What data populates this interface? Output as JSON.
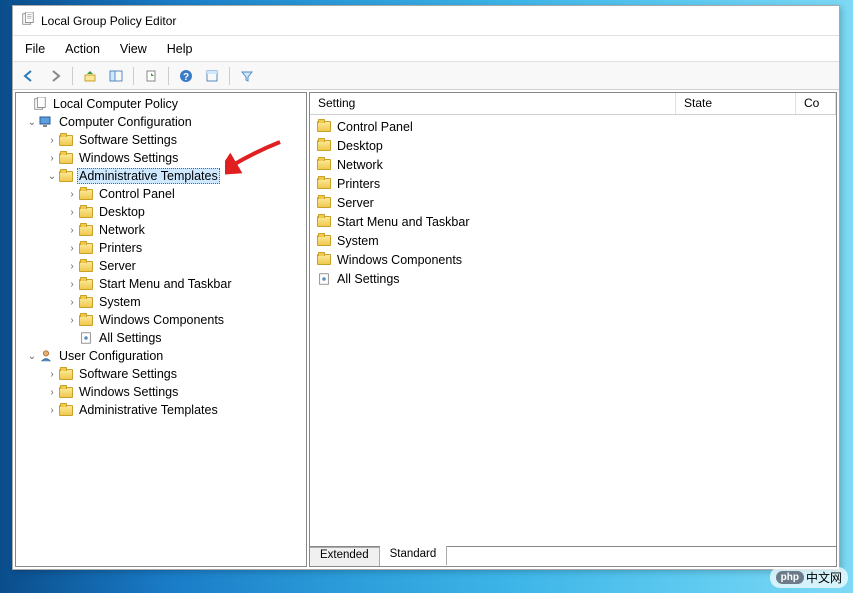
{
  "window": {
    "title": "Local Group Policy Editor"
  },
  "menubar": [
    "File",
    "Action",
    "View",
    "Help"
  ],
  "tree": {
    "root": "Local Computer Policy",
    "computerConfig": "Computer Configuration",
    "cc_software": "Software Settings",
    "cc_windows": "Windows Settings",
    "cc_admin": "Administrative Templates",
    "cc_admin_children": [
      "Control Panel",
      "Desktop",
      "Network",
      "Printers",
      "Server",
      "Start Menu and Taskbar",
      "System",
      "Windows Components",
      "All Settings"
    ],
    "userConfig": "User Configuration",
    "uc_software": "Software Settings",
    "uc_windows": "Windows Settings",
    "uc_admin": "Administrative Templates"
  },
  "list": {
    "headers": {
      "setting": "Setting",
      "state": "State",
      "comment": "Co"
    },
    "items": [
      "Control Panel",
      "Desktop",
      "Network",
      "Printers",
      "Server",
      "Start Menu and Taskbar",
      "System",
      "Windows Components",
      "All Settings"
    ]
  },
  "tabs": {
    "extended": "Extended",
    "standard": "Standard"
  },
  "footer": {
    "logo": "php",
    "text": "中文网"
  }
}
